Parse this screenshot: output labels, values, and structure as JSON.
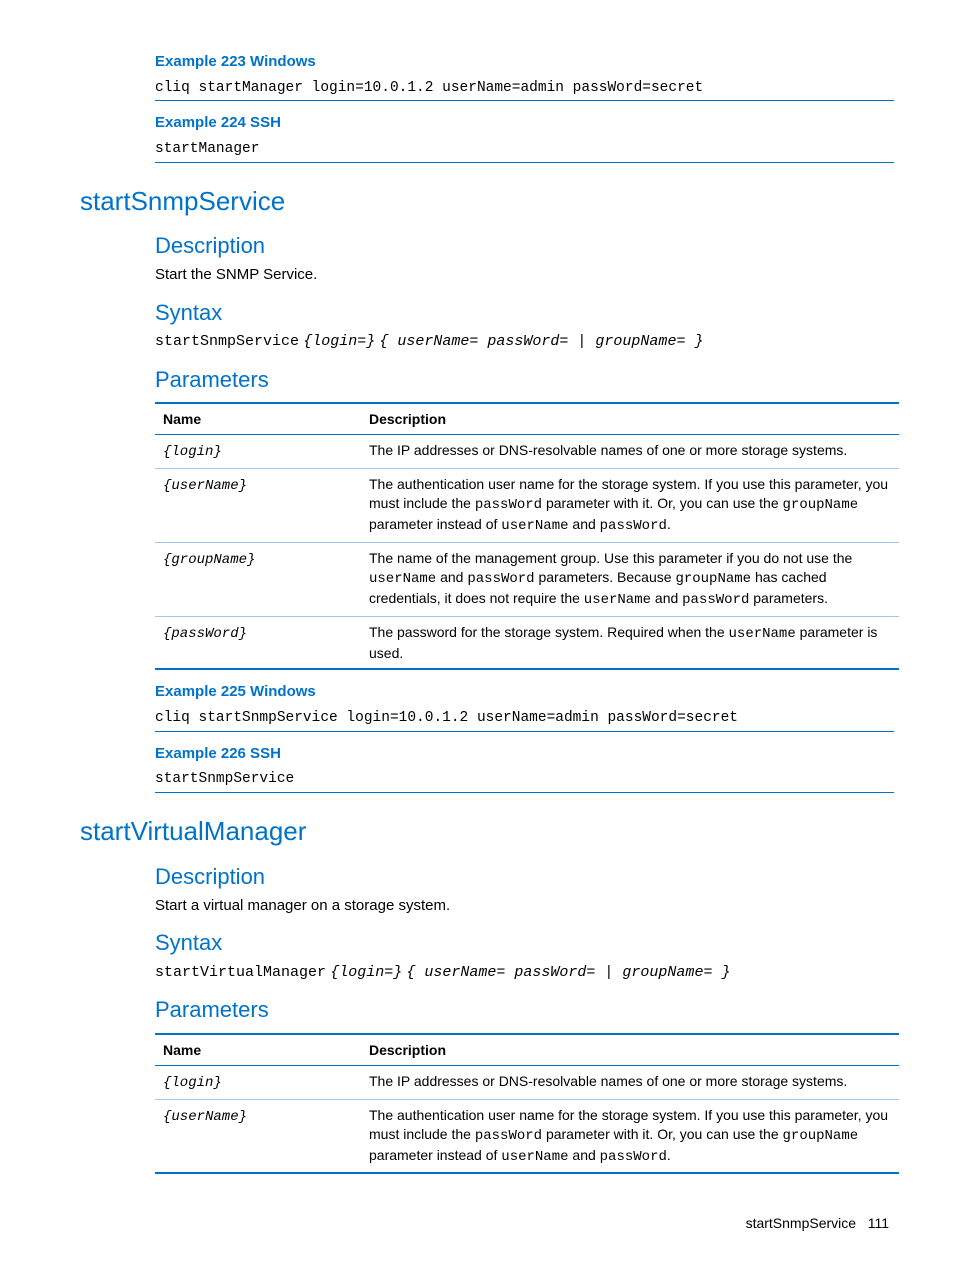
{
  "examples": {
    "e223_title": "Example 223 Windows",
    "e223_code": "cliq startManager login=10.0.1.2 userName=admin passWord=secret",
    "e224_title": "Example 224 SSH",
    "e224_code": "startManager",
    "e225_title": "Example 225 Windows",
    "e225_code": "cliq startSnmpService login=10.0.1.2 userName=admin passWord=secret",
    "e226_title": "Example 226 SSH",
    "e226_code": "startSnmpService"
  },
  "sec_snmp": {
    "title": "startSnmpService",
    "desc_h": "Description",
    "desc_t": "Start the SNMP Service.",
    "syntax_h": "Syntax",
    "syntax_cmd": "startSnmpService",
    "syntax_p1": "{login=}",
    "syntax_p2": "{ userName= passWord= | groupName= }",
    "params_h": "Parameters"
  },
  "sec_vm": {
    "title": "startVirtualManager",
    "desc_h": "Description",
    "desc_t": "Start a virtual manager on a storage system.",
    "syntax_h": "Syntax",
    "syntax_cmd": "startVirtualManager",
    "syntax_p1": "{login=}",
    "syntax_p2": "{ userName= passWord= | groupName= }",
    "params_h": "Parameters"
  },
  "table_headers": {
    "name": "Name",
    "desc": "Description"
  },
  "params_snmp": {
    "r0_name": "{login}",
    "r0_desc": "The IP addresses or DNS-resolvable names of one or more storage systems.",
    "r1_name": "{userName}",
    "r1_a": "The authentication user name for the storage system. If you use this parameter, you must include the ",
    "r1_b": "passWord",
    "r1_c": " parameter with it. Or, you can use the ",
    "r1_d": "groupName",
    "r1_e": " parameter instead of ",
    "r1_f": "userName",
    "r1_g": " and ",
    "r1_h": "passWord",
    "r1_i": ".",
    "r2_name": "{groupName}",
    "r2_a": "The name of the management group. Use this parameter if you do not use the ",
    "r2_b": "userName",
    "r2_c": " and ",
    "r2_d": "passWord",
    "r2_e": " parameters. Because ",
    "r2_f": "groupName",
    "r2_g": " has cached credentials, it does not require the ",
    "r2_h": "userName",
    "r2_i": " and ",
    "r2_j": "passWord",
    "r2_k": " parameters.",
    "r3_name": "{passWord}",
    "r3_a": "The password for the storage system. Required when the ",
    "r3_b": "userName",
    "r3_c": " parameter is used."
  },
  "params_vm": {
    "r0_name": "{login}",
    "r0_desc": "The IP addresses or DNS-resolvable names of one or more storage systems.",
    "r1_name": "{userName}",
    "r1_a": "The authentication user name for the storage system. If you use this parameter, you must include the ",
    "r1_b": "passWord",
    "r1_c": " parameter with it. Or, you can use the ",
    "r1_d": "groupName",
    "r1_e": " parameter instead of ",
    "r1_f": "userName",
    "r1_g": " and ",
    "r1_h": "passWord",
    "r1_i": "."
  },
  "footer": {
    "section": "startSnmpService",
    "page": "111"
  }
}
